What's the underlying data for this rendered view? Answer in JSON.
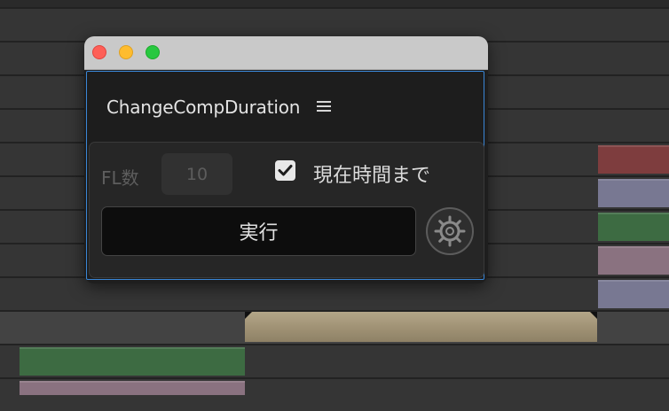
{
  "window": {
    "panel_title": "ChangeCompDuration"
  },
  "form": {
    "fl_label": "FL数",
    "fl_value": "10",
    "checkbox_label": "現在時間まで",
    "checkbox_checked": true,
    "run_label": "実行"
  },
  "icons": {
    "menu": "hamburger-menu-icon",
    "settings": "gear-icon",
    "check": "checkmark-icon"
  },
  "colors": {
    "panel_border": "#3a86d6",
    "clip_red": "#7e3d3e",
    "clip_slate": "#787892",
    "clip_green": "#3d6b42",
    "clip_mauve": "#8a7280",
    "clip_tan": "#a69a7c"
  }
}
